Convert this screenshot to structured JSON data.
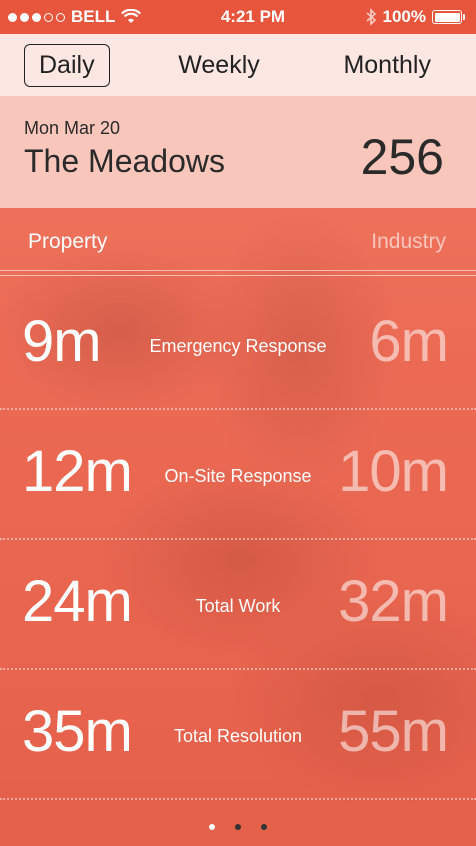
{
  "status_bar": {
    "carrier": "BELL",
    "time": "4:21 PM",
    "battery": "100%",
    "signal_bars": 3,
    "signal_total": 5
  },
  "tabs": [
    {
      "label": "Daily",
      "active": true
    },
    {
      "label": "Weekly",
      "active": false
    },
    {
      "label": "Monthly",
      "active": false
    }
  ],
  "header": {
    "date": "Mon Mar 20",
    "property": "The Meadows",
    "count": "256"
  },
  "columns": {
    "left": "Property",
    "right": "Industry"
  },
  "metrics": [
    {
      "label": "Emergency Response",
      "property": "9m",
      "industry": "6m"
    },
    {
      "label": "On-Site Response",
      "property": "12m",
      "industry": "10m"
    },
    {
      "label": "Total Work",
      "property": "24m",
      "industry": "32m"
    },
    {
      "label": "Total Resolution",
      "property": "35m",
      "industry": "55m"
    }
  ],
  "pager": {
    "pages": 3,
    "current": 1
  },
  "colors": {
    "accent": "#e8553d",
    "tab_bg": "#fce7e3",
    "header_bg": "#facdc4"
  }
}
